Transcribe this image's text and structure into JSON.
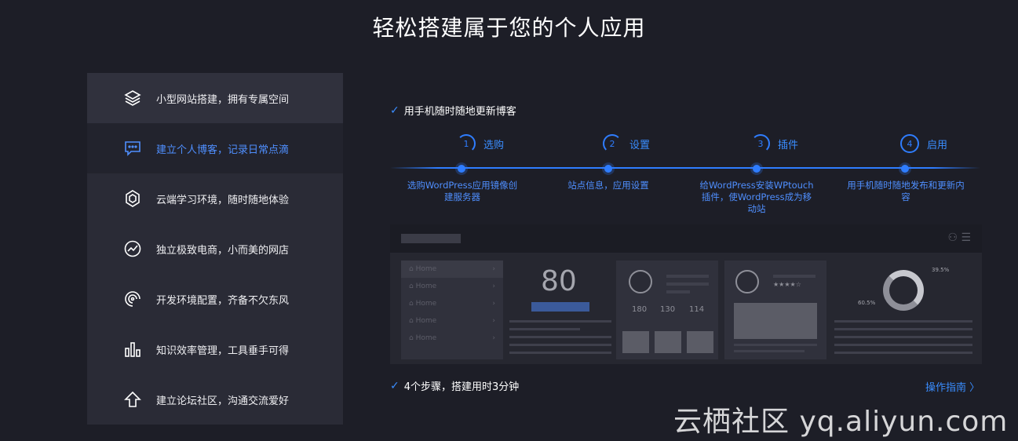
{
  "page": {
    "title": "轻松搭建属于您的个人应用",
    "watermark": "云栖社区 yq.aliyun.com"
  },
  "colors": {
    "background": "#1d1e27",
    "sidebar": "#2a2b36",
    "accent": "#2f7dff"
  },
  "sidebar": {
    "items": [
      {
        "label": "小型网站搭建，拥有专属空间",
        "icon": "layers-icon"
      },
      {
        "label": "建立个人博客，记录日常点滴",
        "icon": "chat-bubble-icon"
      },
      {
        "label": "云端学习环境，随时随地体验",
        "icon": "hexagon-icon"
      },
      {
        "label": "独立极致电商，小而美的网店",
        "icon": "trend-circle-icon"
      },
      {
        "label": "开发环境配置，齐备不欠东风",
        "icon": "swirl-icon"
      },
      {
        "label": "知识效率管理，工具垂手可得",
        "icon": "bar-chart-icon"
      },
      {
        "label": "建立论坛社区，沟通交流爱好",
        "icon": "up-arrow-icon"
      }
    ]
  },
  "main": {
    "heading": "用手机随时随地更新博客",
    "steps": [
      {
        "num": "1",
        "label": "选购",
        "desc": "选购WordPress应用镜像创建服务器"
      },
      {
        "num": "2",
        "label": "设置",
        "desc": "站点信息，应用设置"
      },
      {
        "num": "3",
        "label": "插件",
        "desc": "给WordPress安装WPtouch插件，使WordPress成为移动站"
      },
      {
        "num": "4",
        "label": "启用",
        "desc": "用手机随时随地发布和更新内容"
      }
    ],
    "summary": "4个步骤，搭建用时3分钟",
    "guide_link": "操作指南 〉"
  },
  "preview": {
    "menu": [
      "Home",
      "Home",
      "Home",
      "Home",
      "Home"
    ],
    "big_number": "80",
    "stats": [
      "180",
      "130",
      "114"
    ],
    "donut_labels": [
      "39.5%",
      "60.5%"
    ]
  }
}
